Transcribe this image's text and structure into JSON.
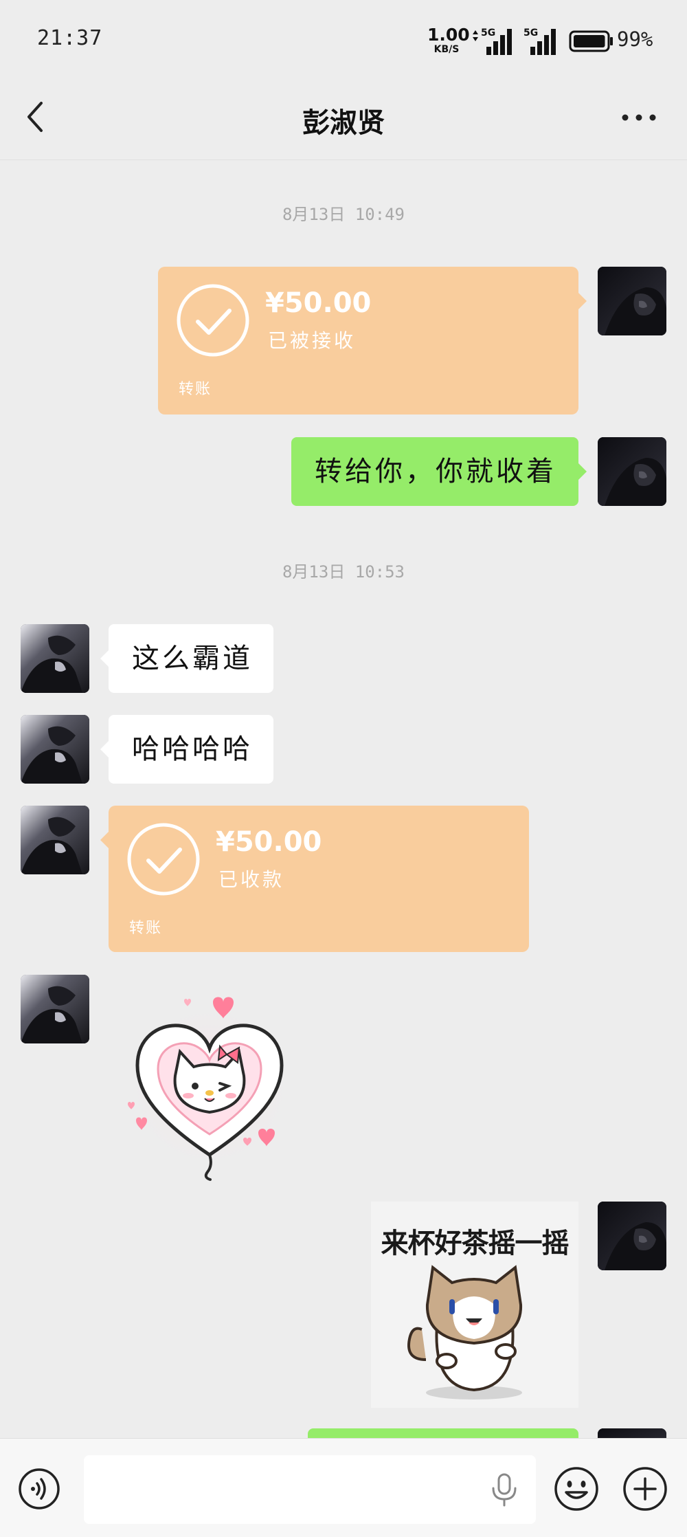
{
  "status_bar": {
    "time": "21:37",
    "net_speed_value": "1.00",
    "net_speed_unit": "KB/S",
    "signal_1_label": "5G",
    "signal_2_label": "5G",
    "battery_level": 0.99,
    "battery_text": "99%"
  },
  "header": {
    "title": "彭淑贤"
  },
  "messages": {
    "ts1": "8月13日 10:49",
    "transfer_out": {
      "amount": "¥50.00",
      "status": "已被接收",
      "label": "转账"
    },
    "msg_out_1": "转给你，你就收着",
    "ts2": "8月13日 10:53",
    "msg_in_1": "这么霸道",
    "msg_in_2": "哈哈哈哈",
    "transfer_in": {
      "amount": "¥50.00",
      "status": "已收款",
      "label": "转账"
    },
    "sticker_cat_caption": "来杯好茶摇一摇"
  },
  "colors": {
    "background": "#ededed",
    "bubble_green": "#95ec69",
    "bubble_white": "#ffffff",
    "transfer_orange": "#f9cd9d"
  },
  "icons": {
    "back": "chevron-left-icon",
    "more": "more-dots-icon",
    "voice": "voice-icon",
    "mic": "mic-icon",
    "emoji": "emoji-icon",
    "plus": "plus-icon"
  }
}
